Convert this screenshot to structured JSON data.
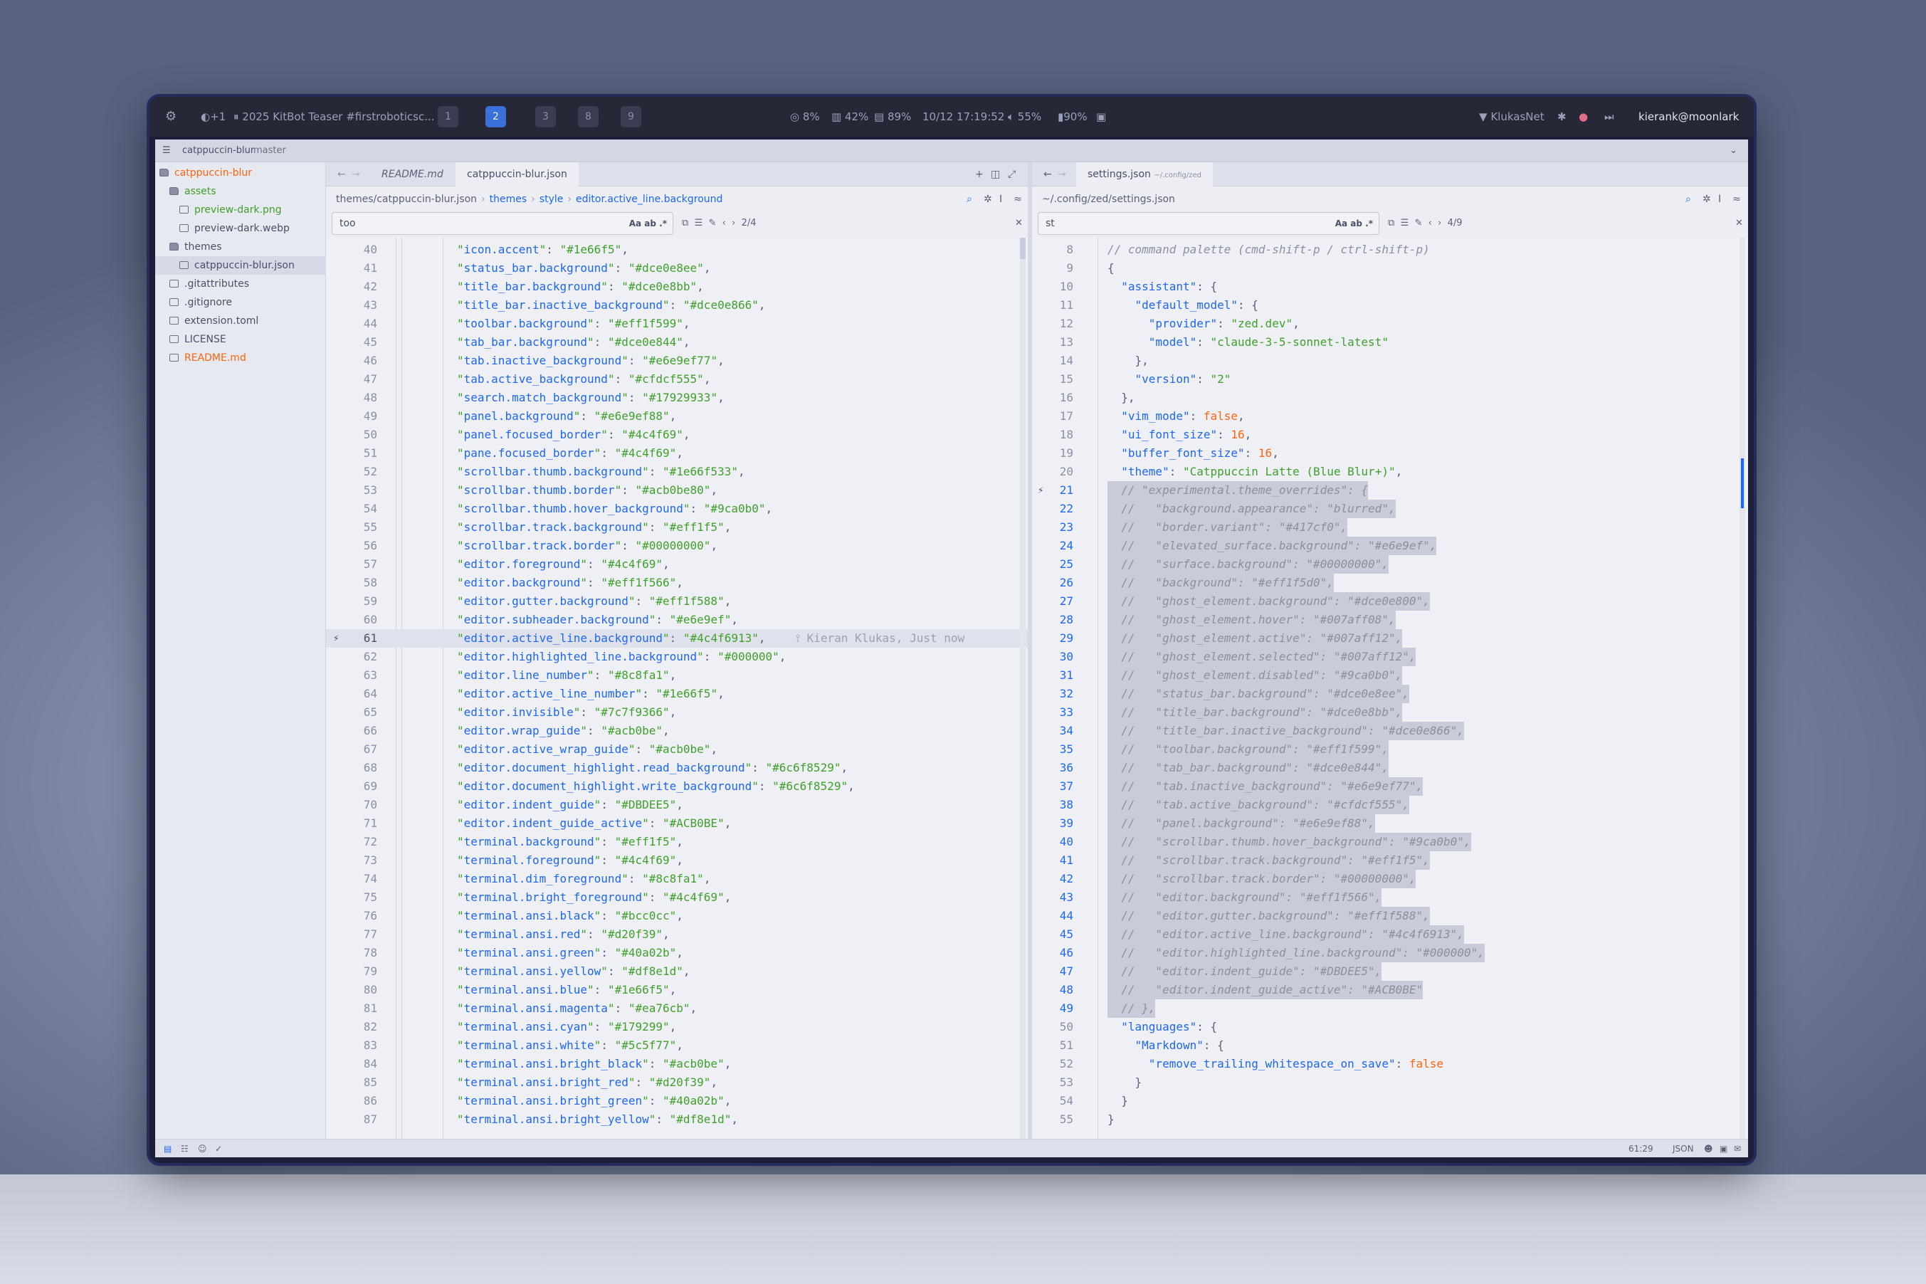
{
  "topbar": {
    "notif": "+1",
    "media": "2025 KitBot Teaser #firstroboticsc...",
    "workspaces": [
      "1",
      "2",
      "3",
      "8",
      "9"
    ],
    "cpu": "8%",
    "mem": "42%",
    "disk": "89%",
    "datetime": "10/12 17:19:52",
    "volume": "55%",
    "battery": "90%",
    "network": "KlukasNet",
    "user": "kierank@moonlark"
  },
  "titlebar": {
    "project": "catppuccin-blur",
    "branch": "master"
  },
  "sidebar": {
    "items": [
      {
        "label": "catppuccin-blur",
        "type": "folder"
      },
      {
        "label": "assets",
        "type": "folder"
      },
      {
        "label": "preview-dark.png",
        "type": "file"
      },
      {
        "label": "preview-dark.webp",
        "type": "file"
      },
      {
        "label": "themes",
        "type": "folder"
      },
      {
        "label": "catppuccin-blur.json",
        "type": "file"
      },
      {
        "label": ".gitattributes",
        "type": "file"
      },
      {
        "label": ".gitignore",
        "type": "file"
      },
      {
        "label": "extension.toml",
        "type": "file"
      },
      {
        "label": "LICENSE",
        "type": "file"
      },
      {
        "label": "README.md",
        "type": "file"
      }
    ]
  },
  "left": {
    "tabs": [
      "README.md",
      "catppuccin-blur.json"
    ],
    "crumb": [
      "themes/catppuccin-blur.json",
      "themes",
      "style",
      "editor.active_line.background"
    ],
    "search": "too",
    "search_opts": "Aa  ab  .*",
    "match": "2/4",
    "blame": "Kieran Klukas, Just now",
    "lines": [
      [
        "40",
        "icon.accent",
        "#1e66f5"
      ],
      [
        "41",
        "status_bar.background",
        "#dce0e8ee"
      ],
      [
        "42",
        "title_bar.background",
        "#dce0e8bb"
      ],
      [
        "43",
        "title_bar.inactive_background",
        "#dce0e866"
      ],
      [
        "44",
        "toolbar.background",
        "#eff1f599"
      ],
      [
        "45",
        "tab_bar.background",
        "#dce0e844"
      ],
      [
        "46",
        "tab.inactive_background",
        "#e6e9ef77"
      ],
      [
        "47",
        "tab.active_background",
        "#cfdcf555"
      ],
      [
        "48",
        "search.match_background",
        "#17929933"
      ],
      [
        "49",
        "panel.background",
        "#e6e9ef88"
      ],
      [
        "50",
        "panel.focused_border",
        "#4c4f69"
      ],
      [
        "51",
        "pane.focused_border",
        "#4c4f69"
      ],
      [
        "52",
        "scrollbar.thumb.background",
        "#1e66f533"
      ],
      [
        "53",
        "scrollbar.thumb.border",
        "#acb0be80"
      ],
      [
        "54",
        "scrollbar.thumb.hover_background",
        "#9ca0b0"
      ],
      [
        "55",
        "scrollbar.track.background",
        "#eff1f5"
      ],
      [
        "56",
        "scrollbar.track.border",
        "#00000000"
      ],
      [
        "57",
        "editor.foreground",
        "#4c4f69"
      ],
      [
        "58",
        "editor.background",
        "#eff1f566"
      ],
      [
        "59",
        "editor.gutter.background",
        "#eff1f588"
      ],
      [
        "60",
        "editor.subheader.background",
        "#e6e9ef"
      ],
      [
        "61",
        "editor.active_line.background",
        "#4c4f6913"
      ],
      [
        "62",
        "editor.highlighted_line.background",
        "#000000"
      ],
      [
        "63",
        "editor.line_number",
        "#8c8fa1"
      ],
      [
        "64",
        "editor.active_line_number",
        "#1e66f5"
      ],
      [
        "65",
        "editor.invisible",
        "#7c7f9366"
      ],
      [
        "66",
        "editor.wrap_guide",
        "#acb0be"
      ],
      [
        "67",
        "editor.active_wrap_guide",
        "#acb0be"
      ],
      [
        "68",
        "editor.document_highlight.read_background",
        "#6c6f8529"
      ],
      [
        "69",
        "editor.document_highlight.write_background",
        "#6c6f8529"
      ],
      [
        "70",
        "editor.indent_guide",
        "#DBDEE5"
      ],
      [
        "71",
        "editor.indent_guide_active",
        "#ACB0BE"
      ],
      [
        "72",
        "terminal.background",
        "#eff1f5"
      ],
      [
        "73",
        "terminal.foreground",
        "#4c4f69"
      ],
      [
        "74",
        "terminal.dim_foreground",
        "#8c8fa1"
      ],
      [
        "75",
        "terminal.bright_foreground",
        "#4c4f69"
      ],
      [
        "76",
        "terminal.ansi.black",
        "#bcc0cc"
      ],
      [
        "77",
        "terminal.ansi.red",
        "#d20f39"
      ],
      [
        "78",
        "terminal.ansi.green",
        "#40a02b"
      ],
      [
        "79",
        "terminal.ansi.yellow",
        "#df8e1d"
      ],
      [
        "80",
        "terminal.ansi.blue",
        "#1e66f5"
      ],
      [
        "81",
        "terminal.ansi.magenta",
        "#ea76cb"
      ],
      [
        "82",
        "terminal.ansi.cyan",
        "#179299"
      ],
      [
        "83",
        "terminal.ansi.white",
        "#5c5f77"
      ],
      [
        "84",
        "terminal.ansi.bright_black",
        "#acb0be"
      ],
      [
        "85",
        "terminal.ansi.bright_red",
        "#d20f39"
      ],
      [
        "86",
        "terminal.ansi.bright_green",
        "#40a02b"
      ],
      [
        "87",
        "terminal.ansi.bright_yellow",
        "#df8e1d"
      ]
    ]
  },
  "right": {
    "tabs": [
      "settings.json"
    ],
    "tab_hint": "~/.config/zed",
    "crumb": "~/.config/zed/settings.json",
    "search": "st",
    "search_opts": "Aa  ab  .*",
    "match": "4/9",
    "lines": [
      [
        "8",
        "c",
        "// command palette (cmd-shift-p / ctrl-shift-p)"
      ],
      [
        "9",
        "p",
        "{"
      ],
      [
        "10",
        "kv",
        "  \"assistant\": {"
      ],
      [
        "11",
        "kv",
        "    \"default_model\": {"
      ],
      [
        "12",
        "kv",
        "      \"provider\": \"zed.dev\","
      ],
      [
        "13",
        "kv",
        "      \"model\": \"claude-3-5-sonnet-latest\""
      ],
      [
        "14",
        "p",
        "    },"
      ],
      [
        "15",
        "kv",
        "    \"version\": \"2\""
      ],
      [
        "16",
        "p",
        "  },"
      ],
      [
        "17",
        "kv",
        "  \"vim_mode\": false,"
      ],
      [
        "18",
        "kv",
        "  \"ui_font_size\": 16,"
      ],
      [
        "19",
        "kv",
        "  \"buffer_font_size\": 16,"
      ],
      [
        "20",
        "kv",
        "  \"theme\": \"Catppuccin Latte (Blue Blur+)\","
      ],
      [
        "21",
        "c",
        "  // \"experimental.theme_overrides\": {"
      ],
      [
        "22",
        "c",
        "  //   \"background.appearance\": \"blurred\","
      ],
      [
        "23",
        "c",
        "  //   \"border.variant\": \"#417cf0\","
      ],
      [
        "24",
        "c",
        "  //   \"elevated_surface.background\": \"#e6e9ef\","
      ],
      [
        "25",
        "c",
        "  //   \"surface.background\": \"#00000000\","
      ],
      [
        "26",
        "c",
        "  //   \"background\": \"#eff1f5d0\","
      ],
      [
        "27",
        "c",
        "  //   \"ghost_element.background\": \"#dce0e800\","
      ],
      [
        "28",
        "c",
        "  //   \"ghost_element.hover\": \"#007aff08\","
      ],
      [
        "29",
        "c",
        "  //   \"ghost_element.active\": \"#007aff12\","
      ],
      [
        "30",
        "c",
        "  //   \"ghost_element.selected\": \"#007aff12\","
      ],
      [
        "31",
        "c",
        "  //   \"ghost_element.disabled\": \"#9ca0b0\","
      ],
      [
        "32",
        "c",
        "  //   \"status_bar.background\": \"#dce0e8ee\","
      ],
      [
        "33",
        "c",
        "  //   \"title_bar.background\": \"#dce0e8bb\","
      ],
      [
        "34",
        "c",
        "  //   \"title_bar.inactive_background\": \"#dce0e866\","
      ],
      [
        "35",
        "c",
        "  //   \"toolbar.background\": \"#eff1f599\","
      ],
      [
        "36",
        "c",
        "  //   \"tab_bar.background\": \"#dce0e844\","
      ],
      [
        "37",
        "c",
        "  //   \"tab.inactive_background\": \"#e6e9ef77\","
      ],
      [
        "38",
        "c",
        "  //   \"tab.active_background\": \"#cfdcf555\","
      ],
      [
        "39",
        "c",
        "  //   \"panel.background\": \"#e6e9ef88\","
      ],
      [
        "40",
        "c",
        "  //   \"scrollbar.thumb.hover_background\": \"#9ca0b0\","
      ],
      [
        "41",
        "c",
        "  //   \"scrollbar.track.background\": \"#eff1f5\","
      ],
      [
        "42",
        "c",
        "  //   \"scrollbar.track.border\": \"#00000000\","
      ],
      [
        "43",
        "c",
        "  //   \"editor.background\": \"#eff1f566\","
      ],
      [
        "44",
        "c",
        "  //   \"editor.gutter.background\": \"#eff1f588\","
      ],
      [
        "45",
        "c",
        "  //   \"editor.active_line.background\": \"#4c4f6913\","
      ],
      [
        "46",
        "c",
        "  //   \"editor.highlighted_line.background\": \"#000000\","
      ],
      [
        "47",
        "c",
        "  //   \"editor.indent_guide\": \"#DBDEE5\","
      ],
      [
        "48",
        "c",
        "  //   \"editor.indent_guide_active\": \"#ACB0BE\""
      ],
      [
        "49",
        "c",
        "  // },"
      ],
      [
        "50",
        "kv",
        "  \"languages\": {"
      ],
      [
        "51",
        "kv",
        "    \"Markdown\": {"
      ],
      [
        "52",
        "kv",
        "      \"remove_trailing_whitespace_on_save\": false"
      ],
      [
        "53",
        "p",
        "    }"
      ],
      [
        "54",
        "p",
        "  }"
      ],
      [
        "55",
        "p",
        "}"
      ]
    ]
  },
  "status": {
    "cursor": "61:29",
    "lang": "JSON"
  },
  "colors": {
    "accent": "#1e66f5",
    "string": "#40a02b",
    "number": "#fe640b",
    "text": "#4c4f69",
    "muted": "#8c8fa1"
  }
}
